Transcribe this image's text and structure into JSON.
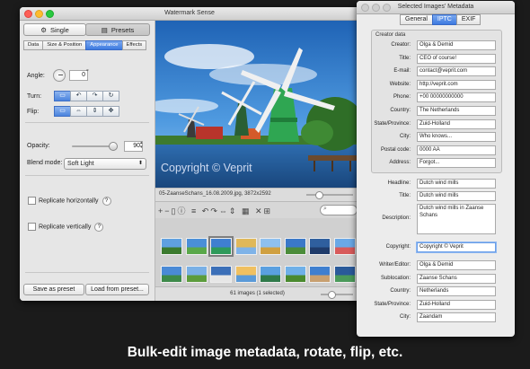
{
  "main_window": {
    "title": "Watermark Sense",
    "mode_single": "Single",
    "mode_presets": "Presets",
    "tabs": [
      "Data",
      "Size & Position",
      "Appearance",
      "Effects"
    ],
    "active_tab": "Appearance",
    "angle_label": "Angle:",
    "angle_value": "0",
    "angle_unit": "°",
    "turn_label": "Turn:",
    "flip_label": "Flip:",
    "opacity_label": "Opacity:",
    "opacity_value": "90",
    "opacity_fraction": 0.9,
    "blend_label": "Blend mode:",
    "blend_value": "Soft Light",
    "replicate_h": "Replicate horizontally",
    "replicate_v": "Replicate vertically",
    "help": "?",
    "save_preset": "Save as preset",
    "load_preset": "Load from preset...",
    "photo_caption": "05-ZaanseSchans_16.08.2009.jpg,  3872x2592",
    "watermark_text": "Copyright © Veprit",
    "status": "61 images (1 selected)"
  },
  "meta_window": {
    "title": "Selected Images' Metadata",
    "tabs": [
      "General",
      "IPTC",
      "EXIF"
    ],
    "active_tab": "IPTC",
    "creator_group_title": "Creator data",
    "creator_rows": [
      {
        "label": "Creator:",
        "value": "Olga & Demid"
      },
      {
        "label": "Title:",
        "value": "CEO of course!"
      },
      {
        "label": "E-mail:",
        "value": "contact@veprit.com"
      },
      {
        "label": "Website:",
        "value": "http://veprit.com"
      },
      {
        "label": "Phone:",
        "value": "+00 00000000000"
      },
      {
        "label": "Country:",
        "value": "The Netherlands"
      },
      {
        "label": "State/Province:",
        "value": "Zuid-Holland"
      },
      {
        "label": "City:",
        "value": "Who knows..."
      },
      {
        "label": "Postal code:",
        "value": "0000 AA"
      },
      {
        "label": "Address:",
        "value": "Forgot..."
      }
    ],
    "headline_label": "Headline:",
    "headline_value": "Dutch wind mills",
    "title_label": "Title:",
    "title_value": "Dutch wind mills",
    "description_label": "Description:",
    "description_value": "Dutch wind mills in Zaanse Schans",
    "copyright_label": "Copyright:",
    "copyright_value": "Copyright © Veprit",
    "location_rows": [
      {
        "label": "Writer/Editor:",
        "value": "Olga & Demid"
      },
      {
        "label": "Sublocation:",
        "value": "Zaanse Schans"
      },
      {
        "label": "Country:",
        "value": "Netherlands"
      },
      {
        "label": "State/Province:",
        "value": "Zuid-Holland"
      },
      {
        "label": "City:",
        "value": "Zaandam"
      }
    ]
  },
  "caption": "Bulk-edit image metadata, rotate, flip, etc."
}
